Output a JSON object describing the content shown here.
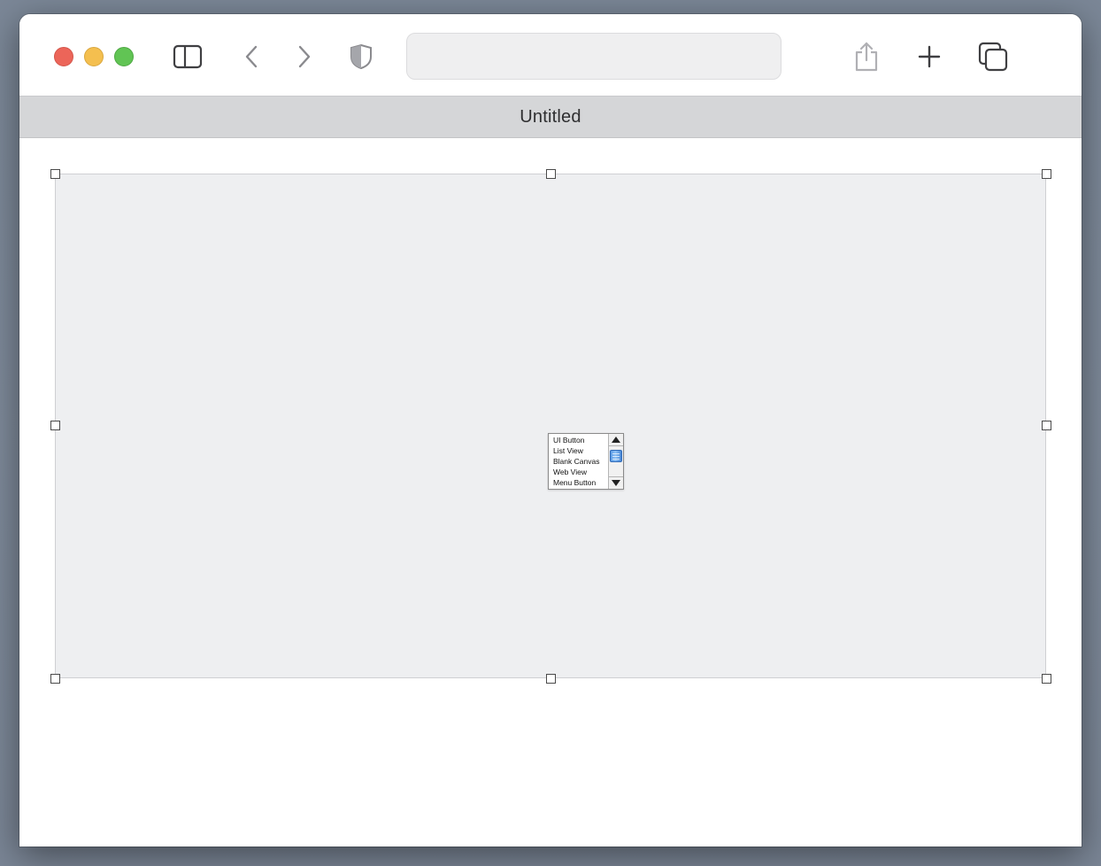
{
  "window": {
    "tab_title": "Untitled"
  },
  "toolbar": {
    "icons": {
      "close": "close-window-button",
      "minimize": "minimize-window-button",
      "maximize": "zoom-window-button",
      "sidebar": "sidebar-icon",
      "back": "chevron-left-icon",
      "forward": "chevron-right-icon",
      "privacy": "shield-icon",
      "share": "share-icon",
      "new_tab": "plus-icon",
      "tab_overview": "tabs-overview-icon"
    },
    "address": {
      "value": "",
      "placeholder": ""
    }
  },
  "canvas": {
    "listbox": {
      "items": [
        "UI Button",
        "List View",
        "Blank Canvas",
        "Web View",
        "Menu Button"
      ],
      "scroll_fraction": 0.15
    }
  },
  "colors": {
    "close": "#ec6559",
    "minimize": "#f4bf4f",
    "maximize": "#61c454",
    "canvas_background": "#eeeff1",
    "scroll_thumb": "#5d9de6"
  }
}
